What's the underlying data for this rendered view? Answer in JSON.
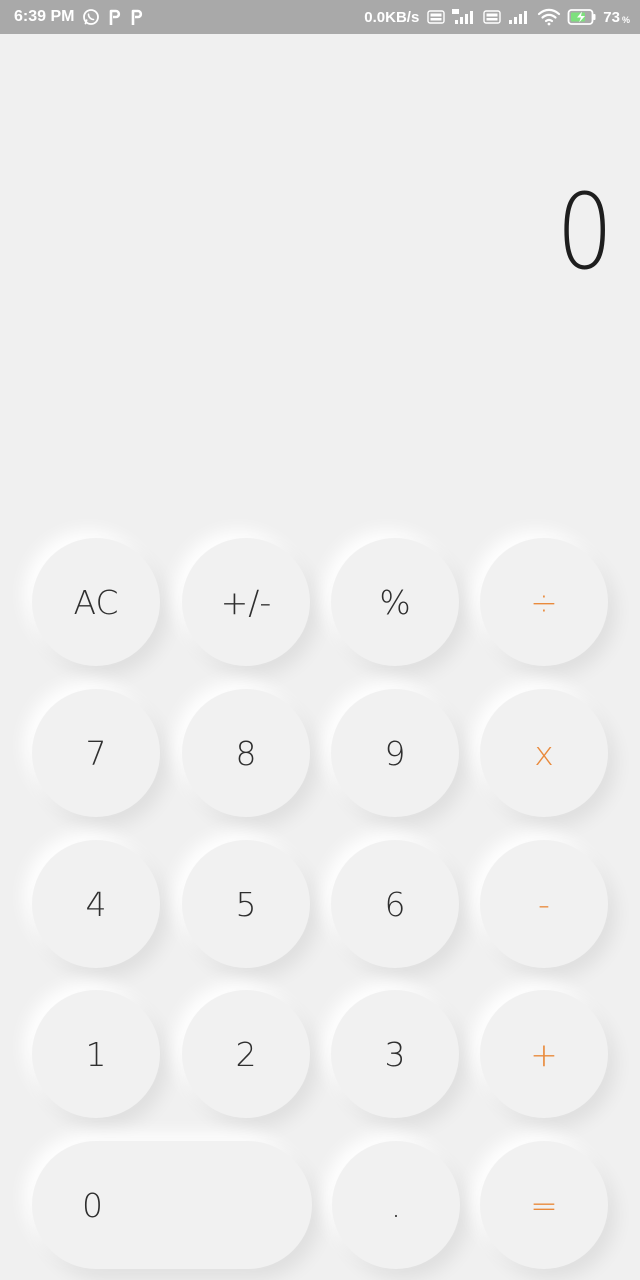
{
  "status_bar": {
    "time": "6:39 PM",
    "net_speed": "0.0KB/s",
    "battery_percent": "73",
    "battery_unit": "%",
    "icons": [
      "whatsapp-icon",
      "p-app-icon",
      "p-app-icon",
      "volte-icon",
      "signal-4g-icon",
      "volte-icon",
      "signal-icon",
      "wifi-icon",
      "battery-charging-icon"
    ]
  },
  "display": {
    "value": "0"
  },
  "keypad": {
    "ac": "AC",
    "sign": "+/-",
    "percent": "%",
    "divide": "÷",
    "seven": "7",
    "eight": "8",
    "nine": "9",
    "multiply": "x",
    "four": "4",
    "five": "5",
    "six": "6",
    "minus": "-",
    "one": "1",
    "two": "2",
    "three": "3",
    "plus": "+",
    "zero": "0",
    "decimal": ".",
    "equals": "="
  },
  "colors": {
    "background": "#f0f0f0",
    "status_bar": "#a9a9a9",
    "operator": "#e98a3c",
    "digit": "#2f2f2f",
    "display_text": "#1e1e1e"
  }
}
